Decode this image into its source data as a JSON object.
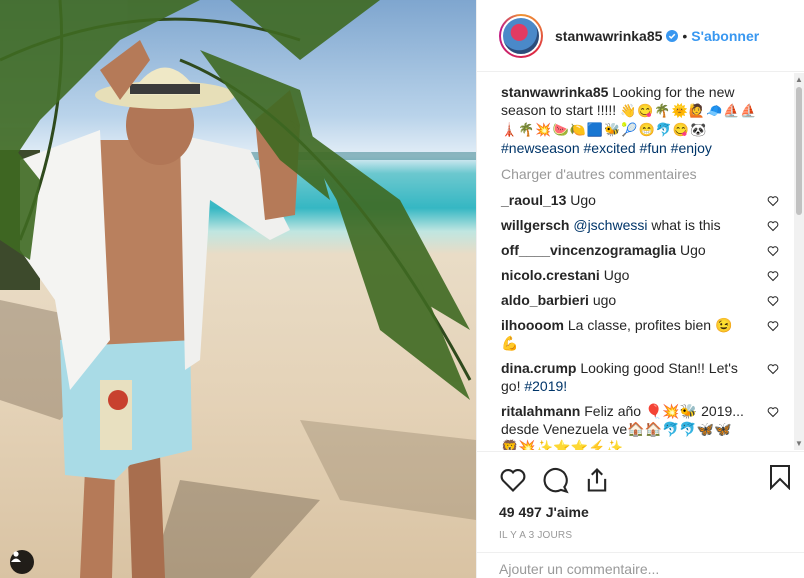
{
  "post": {
    "username": "stanwawrinka85",
    "separator": "•",
    "follow_label": "S'abonner",
    "caption_text": "Looking for the new season to start !!!!!",
    "caption_emojis": "👋😋🌴🌞🙋🧢⛵⛵ 🗼🌴💥🍉🍋🟦🐝🎾😁🐬😋🐼",
    "caption_hashtags": "#newseason #excited #fun #enjoy",
    "load_more_label": "Charger d'autres commentaires",
    "likes": "49 497 J'aime",
    "time_ago": "IL Y A 3 JOURS",
    "add_comment_placeholder": "Ajouter un commentaire..."
  },
  "comments": [
    {
      "user": "_raoul_13",
      "text": "Ugo",
      "tag": ""
    },
    {
      "user": "willgersch",
      "text": "what is this",
      "tag": "@jschwessi"
    },
    {
      "user": "off____vincenzogramaglia",
      "text": "Ugo",
      "tag": ""
    },
    {
      "user": "nicolo.crestani",
      "text": "Ugo",
      "tag": ""
    },
    {
      "user": "aldo_barbieri",
      "text": "ugo",
      "tag": ""
    },
    {
      "user": "ilhoooom",
      "text": "La classe, profites bien 😉 💪",
      "tag": ""
    },
    {
      "user": "dina.crump",
      "text": "Looking good Stan!! Let's go!",
      "tag": "#2019!"
    },
    {
      "user": "ritalahmann",
      "text": "Feliz año 🎈💥🐝 2019... desde Venezuela ve🏠🏠🐬🐬🦋🦋 🦁💥✨⭐⭐⚡✨",
      "tag": ""
    }
  ],
  "colors": {
    "link": "#3897f0",
    "hashtag": "#003569",
    "muted": "#999999"
  },
  "icons": [
    "verified-badge-icon",
    "heart-icon",
    "comment-icon",
    "share-icon",
    "bookmark-icon",
    "user-tag-icon"
  ]
}
